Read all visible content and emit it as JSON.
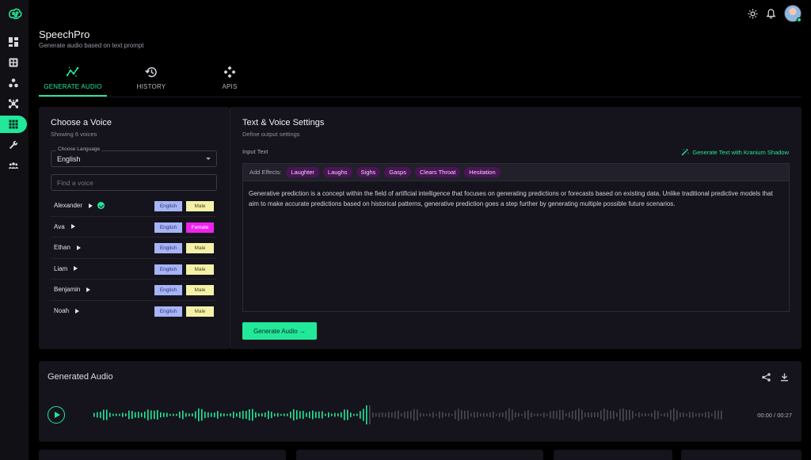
{
  "app": {
    "title": "SpeechPro",
    "subtitle": "Generate audio based on text prompt"
  },
  "sidebar": {
    "logo": "brain-logo-icon",
    "items": [
      {
        "icon": "dashboard-icon"
      },
      {
        "icon": "grid-square-icon"
      },
      {
        "icon": "molecule-icon"
      },
      {
        "icon": "network-icon"
      },
      {
        "icon": "apps-grid-icon",
        "active": true
      },
      {
        "icon": "wrench-icon"
      },
      {
        "icon": "people-icon"
      }
    ]
  },
  "header": {
    "icons": [
      "sun-icon",
      "bell-icon",
      "user-avatar"
    ]
  },
  "tabs": [
    {
      "label": "GENERATE AUDIO",
      "icon": "trend-line-icon",
      "active": true
    },
    {
      "label": "HISTORY",
      "icon": "history-icon"
    },
    {
      "label": "APIS",
      "icon": "api-icon"
    }
  ],
  "voice_panel": {
    "title": "Choose a Voice",
    "subtitle": "Showing 6 voices",
    "language_label": "Choose Language",
    "language_value": "English",
    "search_placeholder": "Find a voice",
    "voices": [
      {
        "name": "Alexander",
        "language": "English",
        "gender": "Male",
        "selected": true
      },
      {
        "name": "Ava",
        "language": "English",
        "gender": "Female"
      },
      {
        "name": "Ethan",
        "language": "English",
        "gender": "Male"
      },
      {
        "name": "Liam",
        "language": "English",
        "gender": "Male"
      },
      {
        "name": "Benjamin",
        "language": "English",
        "gender": "Male"
      },
      {
        "name": "Noah",
        "language": "English",
        "gender": "Male"
      }
    ]
  },
  "settings_panel": {
    "title": "Text & Voice Settings",
    "subtitle": "Define output settings",
    "input_label": "Input Text",
    "generate_text_link": "Generate Text with Kranium Shadow",
    "effects_label": "Add Effects:",
    "effects": [
      "Laughter",
      "Laughs",
      "Sighs",
      "Gasps",
      "Clears Throat",
      "Hesitation"
    ],
    "text": "Generative prediction is a concept within the field of artificial intelligence that focuses on generating predictions or forecasts based on existing data. Unlike traditional predictive models that aim to make accurate predictions based on historical patterns, generative prediction goes a step further by generating multiple possible future scenarios.",
    "generate_button": "Generate Audio →"
  },
  "audio": {
    "title": "Generated Audio",
    "time": "00:00 / 00:27",
    "progress": 0,
    "actions": [
      "share-icon",
      "download-icon"
    ]
  },
  "colors": {
    "accent": "#22e89a",
    "background": "#000000",
    "panel": "#15141c",
    "tag_language": "#a7b4f5",
    "tag_male": "#f4f2a8",
    "tag_female": "#ee22ee",
    "chip": "#4a1456",
    "waveform_played": "#22e89a",
    "waveform_remaining": "#4a4a55"
  }
}
